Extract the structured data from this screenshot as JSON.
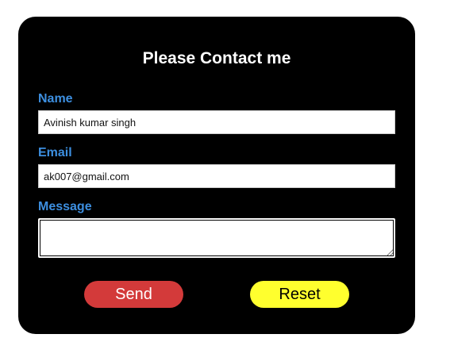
{
  "form": {
    "title": "Please Contact me",
    "name": {
      "label": "Name",
      "value": "Avinish kumar singh"
    },
    "email": {
      "label": "Email",
      "value": "ak007@gmail.com"
    },
    "message": {
      "label": "Message",
      "value": ""
    },
    "buttons": {
      "send_label": "Send",
      "reset_label": "Reset"
    }
  },
  "colors": {
    "card_background": "#000000",
    "label": "#3d8fe0",
    "send_button": "#d33a3a",
    "reset_button": "#ffff2e"
  }
}
